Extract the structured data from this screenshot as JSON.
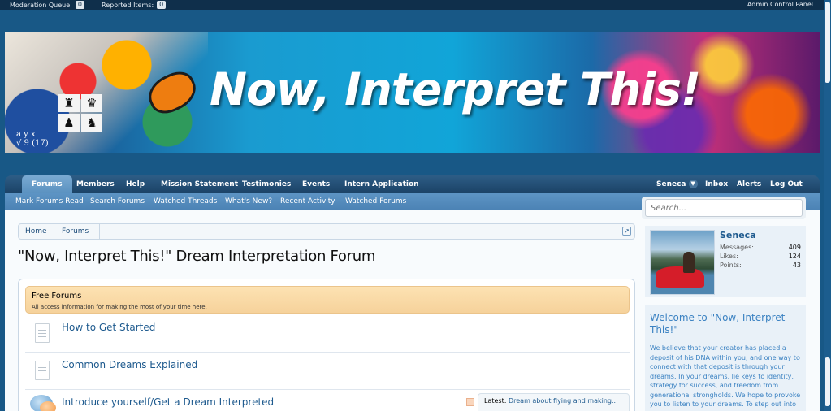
{
  "adminbar": {
    "moderation_label": "Moderation Queue:",
    "moderation_count": "0",
    "reported_label": "Reported Items:",
    "reported_count": "0",
    "acp_label": "Admin Control Panel"
  },
  "banner": {
    "title": "Now, Interpret This!",
    "math": "a y x",
    "math2": "√ 9 (17)"
  },
  "nav": {
    "tabs": [
      "Forums",
      "Members",
      "Help",
      "Mission Statement",
      "Testimonies",
      "Events",
      "Intern Application"
    ],
    "user": "Seneca",
    "inbox": "Inbox",
    "alerts": "Alerts",
    "logout": "Log Out"
  },
  "subnav": [
    "Mark Forums Read",
    "Search Forums",
    "Watched Threads",
    "What's New?",
    "Recent Activity",
    "Watched Forums"
  ],
  "search": {
    "placeholder": "Search..."
  },
  "breadcrumb": [
    "Home",
    "Forums"
  ],
  "page": {
    "title": "\"Now, Interpret This!\" Dream Interpretation Forum"
  },
  "category": {
    "name": "Free Forums",
    "desc": "All access information for making the most of your time here."
  },
  "forums": [
    {
      "title": "How to Get Started"
    },
    {
      "title": "Common Dreams Explained"
    },
    {
      "title": "Introduce yourself/Get a Dream Interpreted",
      "latest_label": "Latest:",
      "latest_title": "Dream about flying and making..."
    }
  ],
  "visitor": {
    "name": "Seneca",
    "messages_label": "Messages:",
    "messages": "409",
    "likes_label": "Likes:",
    "likes": "124",
    "points_label": "Points:",
    "points": "43"
  },
  "welcome": {
    "heading": "Welcome to \"Now, Interpret This!\"",
    "body": "We believe that your creator has placed a deposit of his DNA within you, and one way to connect with that deposit is through your dreams. In your dreams, lie keys to identity, strategy for success, and freedom from generational strongholds. We hope to provoke you to listen to your dreams. To step out into new dimensions and realms of what is"
  },
  "colors": {
    "accent": "#1e5a8e",
    "header_bg": "#185886",
    "category_bg": "#f6d29b"
  }
}
